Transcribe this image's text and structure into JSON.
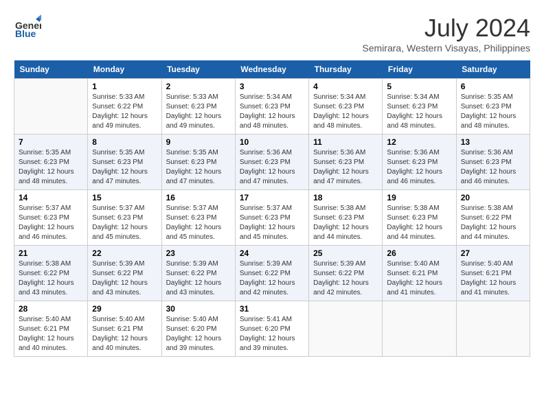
{
  "logo": {
    "line1": "General",
    "line2": "Blue"
  },
  "title": "July 2024",
  "location": "Semirara, Western Visayas, Philippines",
  "weekdays": [
    "Sunday",
    "Monday",
    "Tuesday",
    "Wednesday",
    "Thursday",
    "Friday",
    "Saturday"
  ],
  "weeks": [
    [
      {
        "day": "",
        "info": ""
      },
      {
        "day": "1",
        "info": "Sunrise: 5:33 AM\nSunset: 6:22 PM\nDaylight: 12 hours\nand 49 minutes."
      },
      {
        "day": "2",
        "info": "Sunrise: 5:33 AM\nSunset: 6:23 PM\nDaylight: 12 hours\nand 49 minutes."
      },
      {
        "day": "3",
        "info": "Sunrise: 5:34 AM\nSunset: 6:23 PM\nDaylight: 12 hours\nand 48 minutes."
      },
      {
        "day": "4",
        "info": "Sunrise: 5:34 AM\nSunset: 6:23 PM\nDaylight: 12 hours\nand 48 minutes."
      },
      {
        "day": "5",
        "info": "Sunrise: 5:34 AM\nSunset: 6:23 PM\nDaylight: 12 hours\nand 48 minutes."
      },
      {
        "day": "6",
        "info": "Sunrise: 5:35 AM\nSunset: 6:23 PM\nDaylight: 12 hours\nand 48 minutes."
      }
    ],
    [
      {
        "day": "7",
        "info": "Sunrise: 5:35 AM\nSunset: 6:23 PM\nDaylight: 12 hours\nand 48 minutes."
      },
      {
        "day": "8",
        "info": "Sunrise: 5:35 AM\nSunset: 6:23 PM\nDaylight: 12 hours\nand 47 minutes."
      },
      {
        "day": "9",
        "info": "Sunrise: 5:35 AM\nSunset: 6:23 PM\nDaylight: 12 hours\nand 47 minutes."
      },
      {
        "day": "10",
        "info": "Sunrise: 5:36 AM\nSunset: 6:23 PM\nDaylight: 12 hours\nand 47 minutes."
      },
      {
        "day": "11",
        "info": "Sunrise: 5:36 AM\nSunset: 6:23 PM\nDaylight: 12 hours\nand 47 minutes."
      },
      {
        "day": "12",
        "info": "Sunrise: 5:36 AM\nSunset: 6:23 PM\nDaylight: 12 hours\nand 46 minutes."
      },
      {
        "day": "13",
        "info": "Sunrise: 5:36 AM\nSunset: 6:23 PM\nDaylight: 12 hours\nand 46 minutes."
      }
    ],
    [
      {
        "day": "14",
        "info": "Sunrise: 5:37 AM\nSunset: 6:23 PM\nDaylight: 12 hours\nand 46 minutes."
      },
      {
        "day": "15",
        "info": "Sunrise: 5:37 AM\nSunset: 6:23 PM\nDaylight: 12 hours\nand 45 minutes."
      },
      {
        "day": "16",
        "info": "Sunrise: 5:37 AM\nSunset: 6:23 PM\nDaylight: 12 hours\nand 45 minutes."
      },
      {
        "day": "17",
        "info": "Sunrise: 5:37 AM\nSunset: 6:23 PM\nDaylight: 12 hours\nand 45 minutes."
      },
      {
        "day": "18",
        "info": "Sunrise: 5:38 AM\nSunset: 6:23 PM\nDaylight: 12 hours\nand 44 minutes."
      },
      {
        "day": "19",
        "info": "Sunrise: 5:38 AM\nSunset: 6:23 PM\nDaylight: 12 hours\nand 44 minutes."
      },
      {
        "day": "20",
        "info": "Sunrise: 5:38 AM\nSunset: 6:22 PM\nDaylight: 12 hours\nand 44 minutes."
      }
    ],
    [
      {
        "day": "21",
        "info": "Sunrise: 5:38 AM\nSunset: 6:22 PM\nDaylight: 12 hours\nand 43 minutes."
      },
      {
        "day": "22",
        "info": "Sunrise: 5:39 AM\nSunset: 6:22 PM\nDaylight: 12 hours\nand 43 minutes."
      },
      {
        "day": "23",
        "info": "Sunrise: 5:39 AM\nSunset: 6:22 PM\nDaylight: 12 hours\nand 43 minutes."
      },
      {
        "day": "24",
        "info": "Sunrise: 5:39 AM\nSunset: 6:22 PM\nDaylight: 12 hours\nand 42 minutes."
      },
      {
        "day": "25",
        "info": "Sunrise: 5:39 AM\nSunset: 6:22 PM\nDaylight: 12 hours\nand 42 minutes."
      },
      {
        "day": "26",
        "info": "Sunrise: 5:40 AM\nSunset: 6:21 PM\nDaylight: 12 hours\nand 41 minutes."
      },
      {
        "day": "27",
        "info": "Sunrise: 5:40 AM\nSunset: 6:21 PM\nDaylight: 12 hours\nand 41 minutes."
      }
    ],
    [
      {
        "day": "28",
        "info": "Sunrise: 5:40 AM\nSunset: 6:21 PM\nDaylight: 12 hours\nand 40 minutes."
      },
      {
        "day": "29",
        "info": "Sunrise: 5:40 AM\nSunset: 6:21 PM\nDaylight: 12 hours\nand 40 minutes."
      },
      {
        "day": "30",
        "info": "Sunrise: 5:40 AM\nSunset: 6:20 PM\nDaylight: 12 hours\nand 39 minutes."
      },
      {
        "day": "31",
        "info": "Sunrise: 5:41 AM\nSunset: 6:20 PM\nDaylight: 12 hours\nand 39 minutes."
      },
      {
        "day": "",
        "info": ""
      },
      {
        "day": "",
        "info": ""
      },
      {
        "day": "",
        "info": ""
      }
    ]
  ]
}
